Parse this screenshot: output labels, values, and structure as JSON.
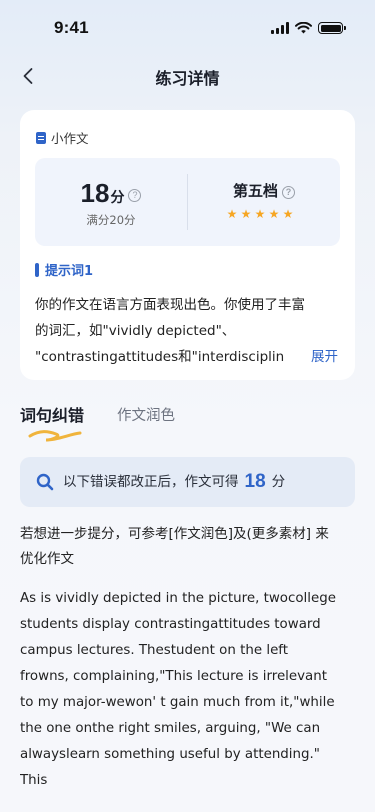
{
  "status_bar": {
    "time": "9:41"
  },
  "nav": {
    "title": "练习详情"
  },
  "card": {
    "tag": "小作文",
    "score": {
      "value": "18",
      "unit": "分",
      "full": "满分20分"
    },
    "level": {
      "label": "第五档",
      "stars": 5
    },
    "hint_title": "提示词1",
    "text_lines": [
      "你的作文在语言方面表现出色。你使用了丰富",
      "的词汇，如\"vividly depicted\"、",
      "\"contrastingattitudes和\"interdisciplin"
    ],
    "expand_label": "展开"
  },
  "tabs": [
    {
      "label": "词句纠错",
      "active": true
    },
    {
      "label": "作文润色",
      "active": false
    }
  ],
  "banner": {
    "prefix": "以下错误都改正后，作文可得",
    "score": "18",
    "suffix": "分"
  },
  "tip_lines": [
    "若想进一步提分，可参考[作文润色]及(更多素材] 来",
    "优化作文"
  ],
  "essay_lines": [
    "As is vividly depicted in the picture, twocollege",
    "students display contrastingattitudes toward",
    "campus lectures. Thestudent on the left",
    "frowns, complaining,\"This lecture is irrelevant",
    "to my major-wewon' t gain much from it,\"while",
    "the one onthe right smiles, arguing, \"We can",
    "alwayslearn something useful by attending.\"",
    "This"
  ],
  "colors": {
    "accent": "#2f64c8",
    "star": "#f6a623",
    "underline": "#f0b43c"
  }
}
